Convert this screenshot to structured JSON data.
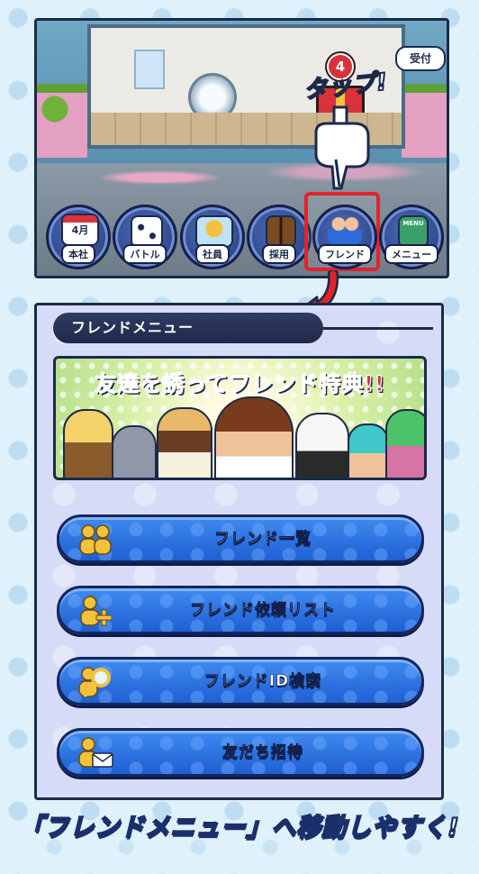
{
  "game": {
    "reception_label": "受付",
    "gift_badge_count": "4",
    "tap_label": "タップ!",
    "nav": [
      {
        "key": "honsha",
        "label": "本社",
        "icon": "calendar-icon",
        "icon_text": "4月"
      },
      {
        "key": "battle",
        "label": "バトル",
        "icon": "dice-icon"
      },
      {
        "key": "shain",
        "label": "社員",
        "icon": "employee-card-icon"
      },
      {
        "key": "saiyo",
        "label": "採用",
        "icon": "door-icon"
      },
      {
        "key": "friend",
        "label": "フレンド",
        "icon": "friends-icon"
      },
      {
        "key": "menu",
        "label": "メニュー",
        "icon": "menu-book-icon",
        "icon_text": "MENU"
      }
    ]
  },
  "panel": {
    "title": "フレンドメニュー",
    "banner_text": "友達を誘ってフレンド特典!!",
    "buttons": [
      {
        "label": "フレンド一覧",
        "icon": "friends-icon"
      },
      {
        "label": "フレンド依頼リスト",
        "icon": "add-friend-icon"
      },
      {
        "label": "フレンドID検索",
        "icon": "search-friend-icon"
      },
      {
        "label": "友だち招待",
        "icon": "invite-mail-icon"
      }
    ]
  },
  "footer": {
    "caption": "「フレンドメニュー」へ移動しやすく!"
  },
  "colors": {
    "highlight": "#e2232b",
    "button_blue": "#2f74e4",
    "navy": "#1b2a4a"
  }
}
